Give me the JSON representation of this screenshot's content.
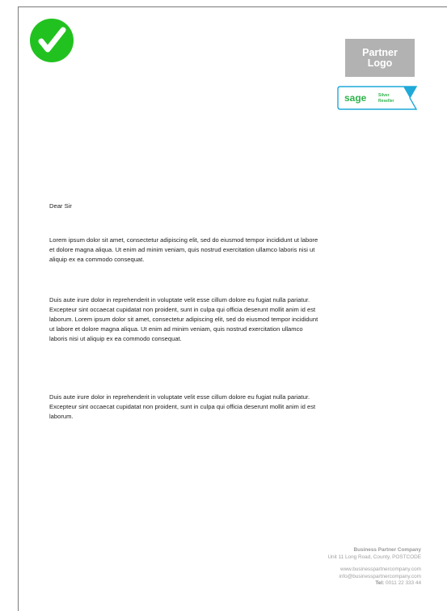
{
  "logo": {
    "placeholder_text_line1": "Partner",
    "placeholder_text_line2": "Logo"
  },
  "badge": {
    "brand": "sage",
    "tier_line1": "Silver",
    "tier_line2": "Reseller",
    "accent_color": "#1fa9d8",
    "brand_color": "#2db34a"
  },
  "check_icon": {
    "color": "#21c21f"
  },
  "letter": {
    "salutation": "Dear Sir",
    "paragraphs": [
      "Lorem ipsum dolor sit amet, consectetur adipiscing elit, sed do eiusmod tempor incididunt ut labore et dolore magna aliqua. Ut enim ad minim veniam, quis nostrud exercitation ullamco laboris nisi ut aliquip ex ea commodo consequat.",
      "Duis aute irure dolor in reprehenderit in voluptate velit esse cillum dolore eu fugiat nulla pariatur. Excepteur sint occaecat cupidatat non proident, sunt in culpa qui officia deserunt mollit anim id est laborum. Lorem ipsum dolor sit amet, consectetur adipiscing elit, sed do eiusmod tempor incididunt ut labore et dolore magna aliqua. Ut enim ad minim veniam, quis nostrud exercitation ullamco laboris nisi ut aliquip ex ea commodo consequat.",
      "Duis aute irure dolor in reprehenderit in voluptate velit esse cillum dolore eu fugiat nulla pariatur. Excepteur sint occaecat cupidatat non proident, sunt in culpa qui officia deserunt mollit anim id est laborum."
    ]
  },
  "footer": {
    "company": "Business Partner Company",
    "address": "Unit 11 Long Road, County, POSTCODE",
    "website": "www.businesspartnercompany.com",
    "email": "info@businesspartnercompany.com",
    "tel_label": "Tel:",
    "tel_number": "0011 22 333 44"
  }
}
